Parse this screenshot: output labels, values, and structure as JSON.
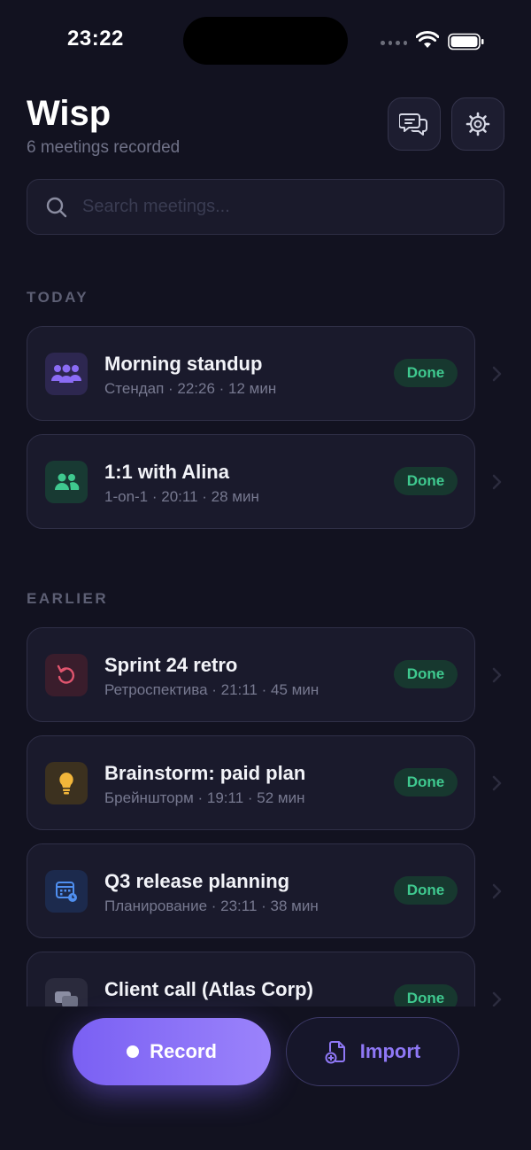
{
  "status_bar": {
    "time": "23:22"
  },
  "header": {
    "title": "Wisp",
    "subtitle": "6 meetings recorded"
  },
  "search": {
    "placeholder": "Search meetings..."
  },
  "sections": [
    {
      "label": "TODAY"
    },
    {
      "label": "EARLIER"
    }
  ],
  "meetings": [
    {
      "title": "Morning standup",
      "meta": "Стендап · 22:26 · 12 мин",
      "status": "Done",
      "icon": "people-group-icon",
      "icon_color": "#8b6cf5",
      "icon_bg": "#2d2750"
    },
    {
      "title": "1:1 with Alina",
      "meta": "1-on-1 · 20:11 · 28 мин",
      "status": "Done",
      "icon": "two-people-icon",
      "icon_color": "#3fc98f",
      "icon_bg": "#183a33"
    },
    {
      "title": "Sprint 24 retro",
      "meta": "Ретроспектива · 21:11 · 45 мин",
      "status": "Done",
      "icon": "rewind-icon",
      "icon_color": "#e0556e",
      "icon_bg": "#3a1d2c"
    },
    {
      "title": "Brainstorm: paid plan",
      "meta": "Брейншторм · 19:11 · 52 мин",
      "status": "Done",
      "icon": "lightbulb-icon",
      "icon_color": "#f2b63a",
      "icon_bg": "#3c311f"
    },
    {
      "title": "Q3 release planning",
      "meta": "Планирование · 23:11 · 38 мин",
      "status": "Done",
      "icon": "calendar-icon",
      "icon_color": "#4f8ff0",
      "icon_bg": "#1c2a4d"
    },
    {
      "title": "Client call (Atlas Corp)",
      "meta": "",
      "status": "Done",
      "icon": "chat-bubbles-icon",
      "icon_color": "#8b8ea3",
      "icon_bg": "#2a2a3c"
    }
  ],
  "actions": {
    "record_label": "Record",
    "import_label": "Import"
  },
  "colors": {
    "accent": "#8b6cf5",
    "done_text": "#3fc98f",
    "done_bg": "#17382f",
    "background": "#121220"
  }
}
